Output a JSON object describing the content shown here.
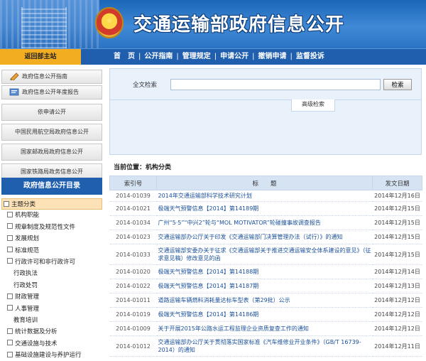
{
  "header": {
    "title": "交通运输部政府信息公开",
    "emblem": "national-emblem"
  },
  "nav": {
    "back_home": "返回部主站",
    "links": [
      "首　页",
      "公开指南",
      "管理规定",
      "申请公开",
      "撤销申请",
      "监督投诉"
    ]
  },
  "sidebar": {
    "guide": "政府信息公开指南",
    "annual_report": "政府信息公开年度报告",
    "apply": "依申请公开",
    "caac": "中国民用航空局政府信息公开",
    "post": "国家邮政局政府信息公开",
    "railway": "国家铁路局政务信息公开",
    "catalog_title": "政府信息公开目录",
    "tree": [
      {
        "label": "主题分类",
        "kind": "root"
      },
      {
        "label": "机构职能",
        "kind": "node"
      },
      {
        "label": "规章制度及规范性文件",
        "kind": "node"
      },
      {
        "label": "发展规划",
        "kind": "node"
      },
      {
        "label": "标准规范",
        "kind": "node"
      },
      {
        "label": "行政许可和非行政许可",
        "kind": "node"
      },
      {
        "label": "行政执法",
        "kind": "leaf"
      },
      {
        "label": "行政处罚",
        "kind": "leaf"
      },
      {
        "label": "财政管理",
        "kind": "node"
      },
      {
        "label": "人事管理",
        "kind": "node"
      },
      {
        "label": "教育培训",
        "kind": "leaf"
      },
      {
        "label": "统计数据及分析",
        "kind": "node"
      },
      {
        "label": "交通设施与技术",
        "kind": "node"
      },
      {
        "label": "基础设施建设与养护运行",
        "kind": "node"
      }
    ]
  },
  "search": {
    "label": "全文检索",
    "placeholder": "",
    "button": "检索",
    "advanced": "高级检索"
  },
  "location": "当前位置：机构分类",
  "table": {
    "headers": [
      "索引号",
      "标　　题",
      "发文日期"
    ],
    "rows": [
      [
        "2014-01039",
        "2014年交通运输部科学技术研究计划",
        "2014年12月16日"
      ],
      [
        "2014-01021",
        "极端天气预警信息【2014】第14189期",
        "2014年12月15日"
      ],
      [
        "2014-01034",
        "广州“5·5”“中兴2”轮与“MOL MOTIVATOR”轮碰撞事故调查报告",
        "2014年12月15日"
      ],
      [
        "2014-01023",
        "交通运输部办公厅关于印发《交通运输部门决算管理办法（试行）》的通知",
        "2014年12月15日"
      ],
      [
        "2014-01033",
        "交通运输部安委办关于征求《交通运输部关于推进交通运输安全体系建设的意见》（征求意见稿）修改意见的函",
        "2014年12月15日"
      ],
      [
        "2014-01020",
        "极端天气预警信息【2014】第14188期",
        "2014年12月14日"
      ],
      [
        "2014-01022",
        "极端天气预警信息【2014】第14187期",
        "2014年12月13日"
      ],
      [
        "2014-01011",
        "道路运输车辆燃料消耗量达标车型表（第29批）公示",
        "2014年12月12日"
      ],
      [
        "2014-01019",
        "极端天气预警信息【2014】第14186期",
        "2014年12月12日"
      ],
      [
        "2014-01009",
        "关于开展2015年公路水运工程监理企业资质复查工作的通知",
        "2014年12月12日"
      ],
      [
        "2014-01012",
        "交通运输部办公厅关于贯彻落实国家标准《汽车维修业开业条件》（GB/T 16739-2014）的通知",
        "2014年12月11日"
      ]
    ]
  },
  "colors": {
    "nav_blue": "#1f5fae",
    "back_home_orange": "#f3ad21",
    "link_blue": "#1a4f9a"
  }
}
